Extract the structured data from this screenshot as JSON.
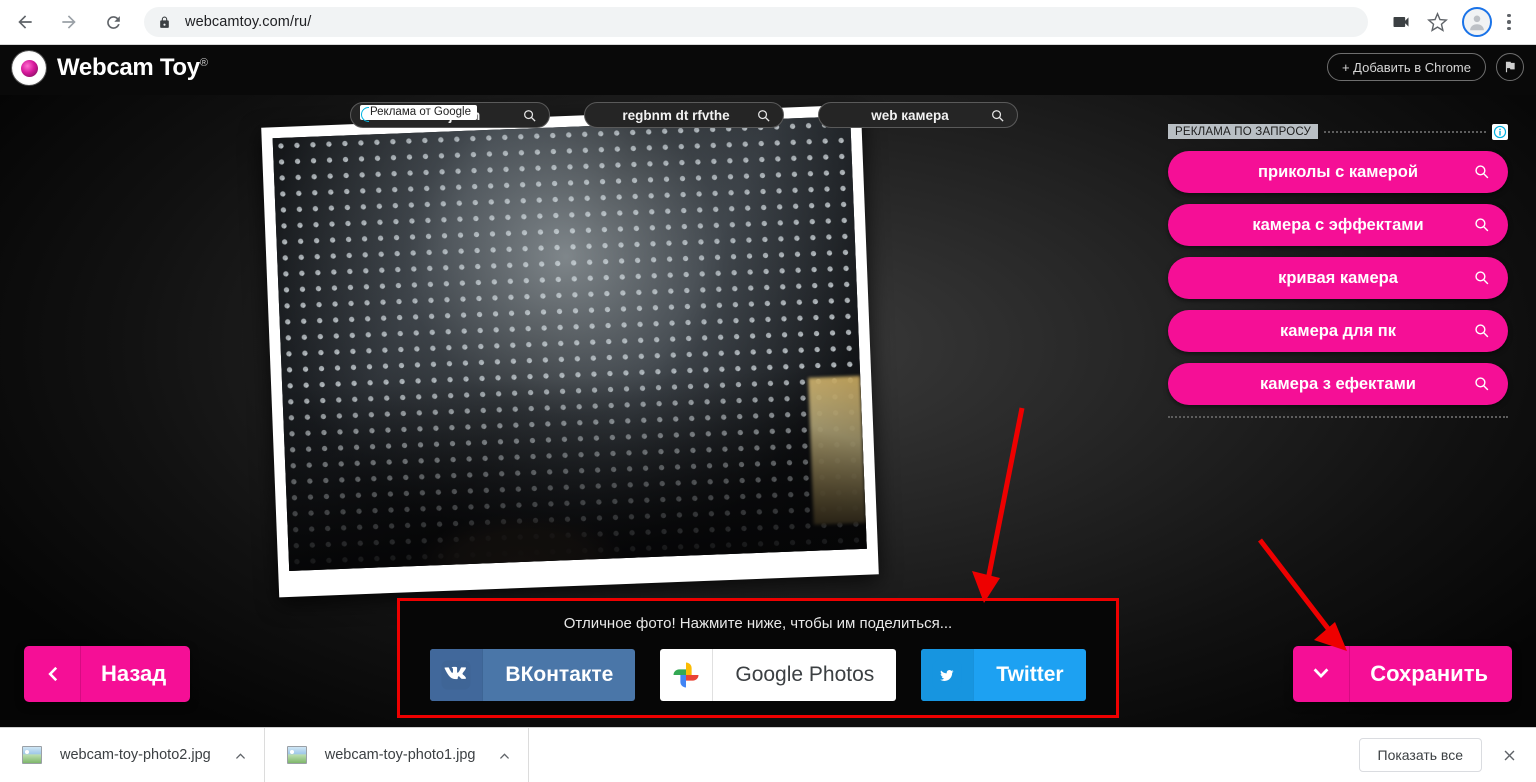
{
  "browser": {
    "back_icon": "back-arrow-icon",
    "forward_icon": "forward-arrow-icon",
    "reload_icon": "reload-icon",
    "lock_icon": "lock-icon",
    "url": "webcamtoy.com/ru/",
    "cast_icon": "video-camera-icon",
    "bookmark_icon": "star-icon",
    "profile_icon": "profile-avatar-icon",
    "menu_icon": "kebab-menu-icon"
  },
  "site_header": {
    "logo_text": "Webcam Toy",
    "logo_registered": "®",
    "ads_badge": "Реклама от Google",
    "ad_searches": [
      {
        "query": "dt rfv vjltkm"
      },
      {
        "query": "regbnm dt rfvthe"
      },
      {
        "query": "web камера"
      }
    ],
    "add_to_chrome": "+ Добавить в Chrome",
    "flag_icon": "flag-icon"
  },
  "ad_panel": {
    "title": "РЕКЛАМА ПО ЗАПРОСУ",
    "info_icon": "info-circle-icon",
    "accent_color": "#f50f96",
    "items": [
      {
        "label": "приколы с камерой"
      },
      {
        "label": "камера с эффектами"
      },
      {
        "label": "кривая камера"
      },
      {
        "label": "камера для пк"
      },
      {
        "label": "камера з ефектами"
      }
    ]
  },
  "photo": {
    "alt": "webcam-photo-mesh-fabric",
    "rotation_deg": -2.2
  },
  "share_panel": {
    "highlight_color": "#ee0000",
    "message": "Отличное фото! Нажмите ниже, чтобы им поделиться...",
    "buttons": [
      {
        "label": "ВКонтакте",
        "icon": "vk-icon",
        "color": "#4a76a8"
      },
      {
        "label": "Google Photos",
        "icon": "google-photos-icon",
        "color": "#ffffff"
      },
      {
        "label": "Twitter",
        "icon": "twitter-bird-icon",
        "color": "#1da1f2"
      }
    ]
  },
  "nav": {
    "back_label": "Назад",
    "back_icon": "chevron-left-icon",
    "save_label": "Сохранить",
    "save_icon": "chevron-down-icon"
  },
  "annotations": {
    "arrow_color": "#ee0000",
    "arrow_count": 2
  },
  "download_shelf": {
    "items": [
      {
        "name": "webcam-toy-photo2.jpg",
        "icon": "image-file-icon",
        "caret": "chevron-up-icon"
      },
      {
        "name": "webcam-toy-photo1.jpg",
        "icon": "image-file-icon",
        "caret": "chevron-up-icon"
      }
    ],
    "show_all": "Показать все",
    "close_icon": "close-icon"
  }
}
